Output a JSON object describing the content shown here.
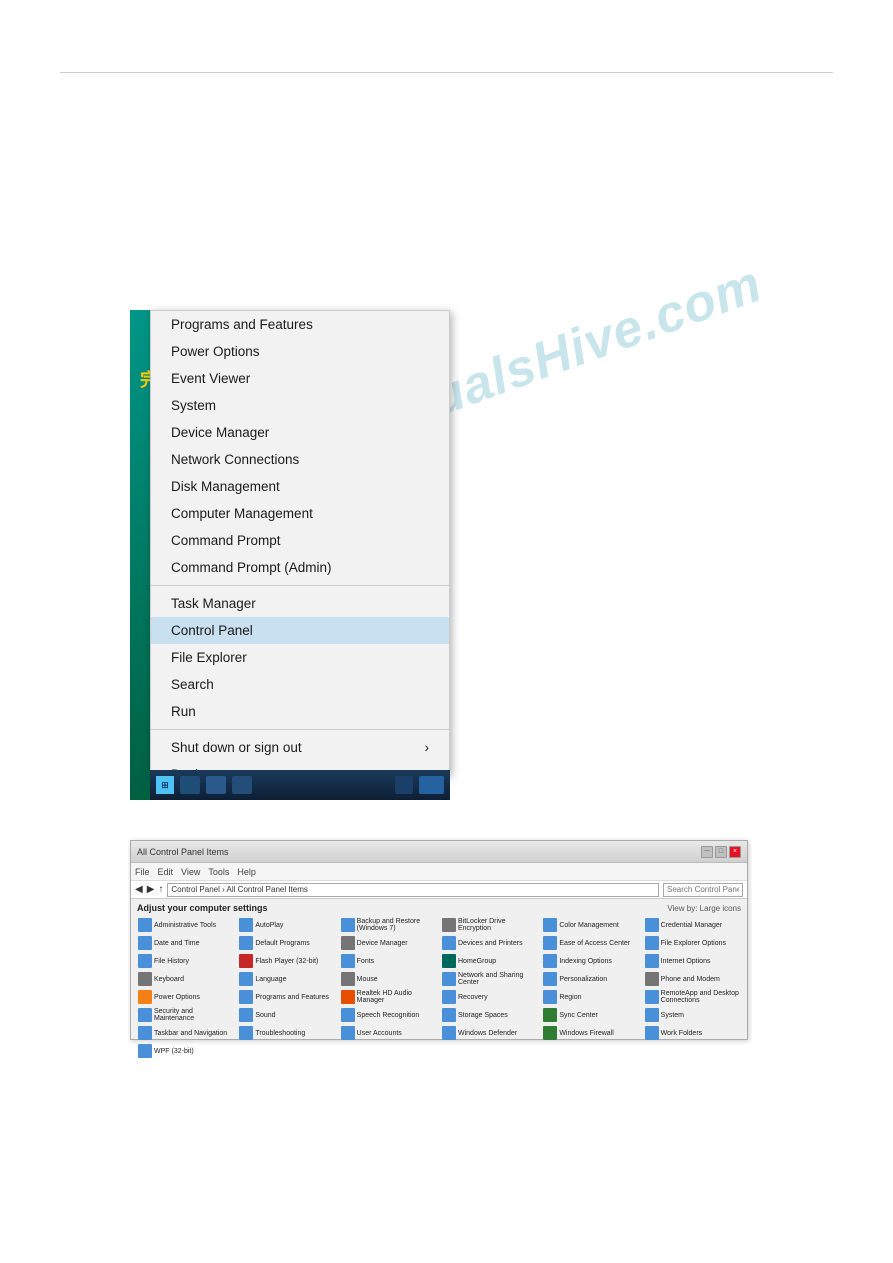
{
  "page": {
    "background": "#ffffff",
    "watermark": "manualsHive.com"
  },
  "context_menu": {
    "items": [
      {
        "label": "Programs and Features",
        "highlighted": false,
        "has_arrow": false
      },
      {
        "label": "Power Options",
        "highlighted": false,
        "has_arrow": false
      },
      {
        "label": "Event Viewer",
        "highlighted": false,
        "has_arrow": false
      },
      {
        "label": "System",
        "highlighted": false,
        "has_arrow": false
      },
      {
        "label": "Device Manager",
        "highlighted": false,
        "has_arrow": false
      },
      {
        "label": "Network Connections",
        "highlighted": false,
        "has_arrow": false
      },
      {
        "label": "Disk Management",
        "highlighted": false,
        "has_arrow": false
      },
      {
        "label": "Computer Management",
        "highlighted": false,
        "has_arrow": false
      },
      {
        "label": "Command Prompt",
        "highlighted": false,
        "has_arrow": false
      },
      {
        "label": "Command Prompt (Admin)",
        "highlighted": false,
        "has_arrow": false
      },
      {
        "divider": true
      },
      {
        "label": "Task Manager",
        "highlighted": false,
        "has_arrow": false
      },
      {
        "label": "Control Panel",
        "highlighted": true,
        "has_arrow": false
      },
      {
        "label": "File Explorer",
        "highlighted": false,
        "has_arrow": false
      },
      {
        "label": "Search",
        "highlighted": false,
        "has_arrow": false
      },
      {
        "label": "Run",
        "highlighted": false,
        "has_arrow": false
      },
      {
        "divider": true
      },
      {
        "label": "Shut down or sign out",
        "highlighted": false,
        "has_arrow": true
      },
      {
        "label": "Desktop",
        "highlighted": false,
        "has_arrow": false
      }
    ]
  },
  "control_panel": {
    "title": "All Control Panel Items",
    "title_bar": "All Control Panel Items",
    "breadcrumb": "Control Panel > All Control Panel Items",
    "menu_items": [
      "File",
      "Edit",
      "View",
      "Tools",
      "Help"
    ],
    "address": "Control Panel > All Control Panel Items",
    "search_placeholder": "Search Control Panel for s...",
    "subtitle": "Adjust your computer settings",
    "view_by": "View by: Large icons",
    "items": [
      {
        "label": "Administrative Tools",
        "color": "blue"
      },
      {
        "label": "AutoPlay",
        "color": "blue"
      },
      {
        "label": "Backup and Restore (Windows 7)",
        "color": "blue"
      },
      {
        "label": "BitLocker Drive Encryption",
        "color": "blue"
      },
      {
        "label": "Color Management",
        "color": "blue"
      },
      {
        "label": "Credential Manager",
        "color": "blue"
      },
      {
        "label": "Date and Time",
        "color": "blue"
      },
      {
        "label": "Default Programs",
        "color": "blue"
      },
      {
        "label": "Device Manager",
        "color": "blue"
      },
      {
        "label": "Devices and Printers",
        "color": "blue"
      },
      {
        "label": "Ease of Access Center",
        "color": "blue"
      },
      {
        "label": "File Explorer Options",
        "color": "blue"
      },
      {
        "label": "File History",
        "color": "blue"
      },
      {
        "label": "Flash Player (32-bit)",
        "color": "red"
      },
      {
        "label": "Fonts",
        "color": "blue"
      },
      {
        "label": "HomeGroup",
        "color": "teal"
      },
      {
        "label": "Indexing Options",
        "color": "blue"
      },
      {
        "label": "Internet Options",
        "color": "blue"
      },
      {
        "label": "Keyboard",
        "color": "grey"
      },
      {
        "label": "Language",
        "color": "blue"
      },
      {
        "label": "Mouse",
        "color": "grey"
      },
      {
        "label": "Network and Sharing Center",
        "color": "blue"
      },
      {
        "label": "Personalization",
        "color": "blue"
      },
      {
        "label": "Phone and Modem",
        "color": "grey"
      },
      {
        "label": "Power Options",
        "color": "yellow"
      },
      {
        "label": "Programs and Features",
        "color": "blue"
      },
      {
        "label": "Realtek HD Audio Manager",
        "color": "orange"
      },
      {
        "label": "Recovery",
        "color": "blue"
      },
      {
        "label": "Region",
        "color": "blue"
      },
      {
        "label": "RemoteApp and Desktop Connections",
        "color": "blue"
      },
      {
        "label": "Security and Maintenance",
        "color": "blue"
      },
      {
        "label": "Sound",
        "color": "blue"
      },
      {
        "label": "Speech Recognition",
        "color": "blue"
      },
      {
        "label": "Storage Spaces",
        "color": "blue"
      },
      {
        "label": "Sync Center",
        "color": "green"
      },
      {
        "label": "System",
        "color": "blue"
      },
      {
        "label": "Taskbar and Navigation",
        "color": "blue"
      },
      {
        "label": "Troubleshooting",
        "color": "blue"
      },
      {
        "label": "User Accounts",
        "color": "blue"
      },
      {
        "label": "Windows Defender",
        "color": "blue"
      },
      {
        "label": "Windows Firewall",
        "color": "green"
      },
      {
        "label": "Work Folders",
        "color": "blue"
      },
      {
        "label": "WPF (32-bit)",
        "color": "blue"
      }
    ]
  }
}
